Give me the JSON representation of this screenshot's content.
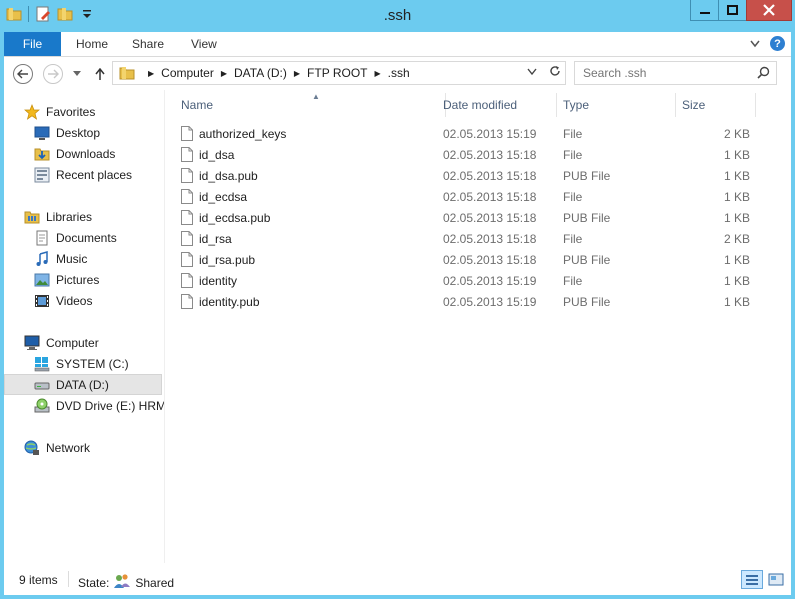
{
  "window": {
    "title": ".ssh"
  },
  "ribbon": {
    "tabs": [
      "File",
      "Home",
      "Share",
      "View"
    ]
  },
  "address": {
    "crumbs": [
      "Computer",
      "DATA (D:)",
      "FTP ROOT",
      ".ssh"
    ]
  },
  "search": {
    "placeholder": "Search .ssh"
  },
  "nav": {
    "favorites": {
      "label": "Favorites",
      "items": [
        "Desktop",
        "Downloads",
        "Recent places"
      ]
    },
    "libraries": {
      "label": "Libraries",
      "items": [
        "Documents",
        "Music",
        "Pictures",
        "Videos"
      ]
    },
    "computer": {
      "label": "Computer",
      "items": [
        "SYSTEM (C:)",
        "DATA (D:)",
        "DVD Drive (E:) HRM_"
      ]
    },
    "network": {
      "label": "Network"
    }
  },
  "columns": {
    "name": "Name",
    "date": "Date modified",
    "type": "Type",
    "size": "Size"
  },
  "files": [
    {
      "name": "authorized_keys",
      "date": "02.05.2013 15:19",
      "type": "File",
      "size": "2 KB"
    },
    {
      "name": "id_dsa",
      "date": "02.05.2013 15:18",
      "type": "File",
      "size": "1 KB"
    },
    {
      "name": "id_dsa.pub",
      "date": "02.05.2013 15:18",
      "type": "PUB File",
      "size": "1 KB"
    },
    {
      "name": "id_ecdsa",
      "date": "02.05.2013 15:18",
      "type": "File",
      "size": "1 KB"
    },
    {
      "name": "id_ecdsa.pub",
      "date": "02.05.2013 15:18",
      "type": "PUB File",
      "size": "1 KB"
    },
    {
      "name": "id_rsa",
      "date": "02.05.2013 15:18",
      "type": "File",
      "size": "2 KB"
    },
    {
      "name": "id_rsa.pub",
      "date": "02.05.2013 15:18",
      "type": "PUB File",
      "size": "1 KB"
    },
    {
      "name": "identity",
      "date": "02.05.2013 15:19",
      "type": "File",
      "size": "1 KB"
    },
    {
      "name": "identity.pub",
      "date": "02.05.2013 15:19",
      "type": "PUB File",
      "size": "1 KB"
    }
  ],
  "status": {
    "count": "9 items",
    "state_label": "State:",
    "state_value": "Shared"
  },
  "colors": {
    "frame": "#6ccbef",
    "file_tab": "#1979ca",
    "close_button": "#c7504a",
    "selection": "#e5e5e5",
    "header_text": "#4c607a"
  }
}
